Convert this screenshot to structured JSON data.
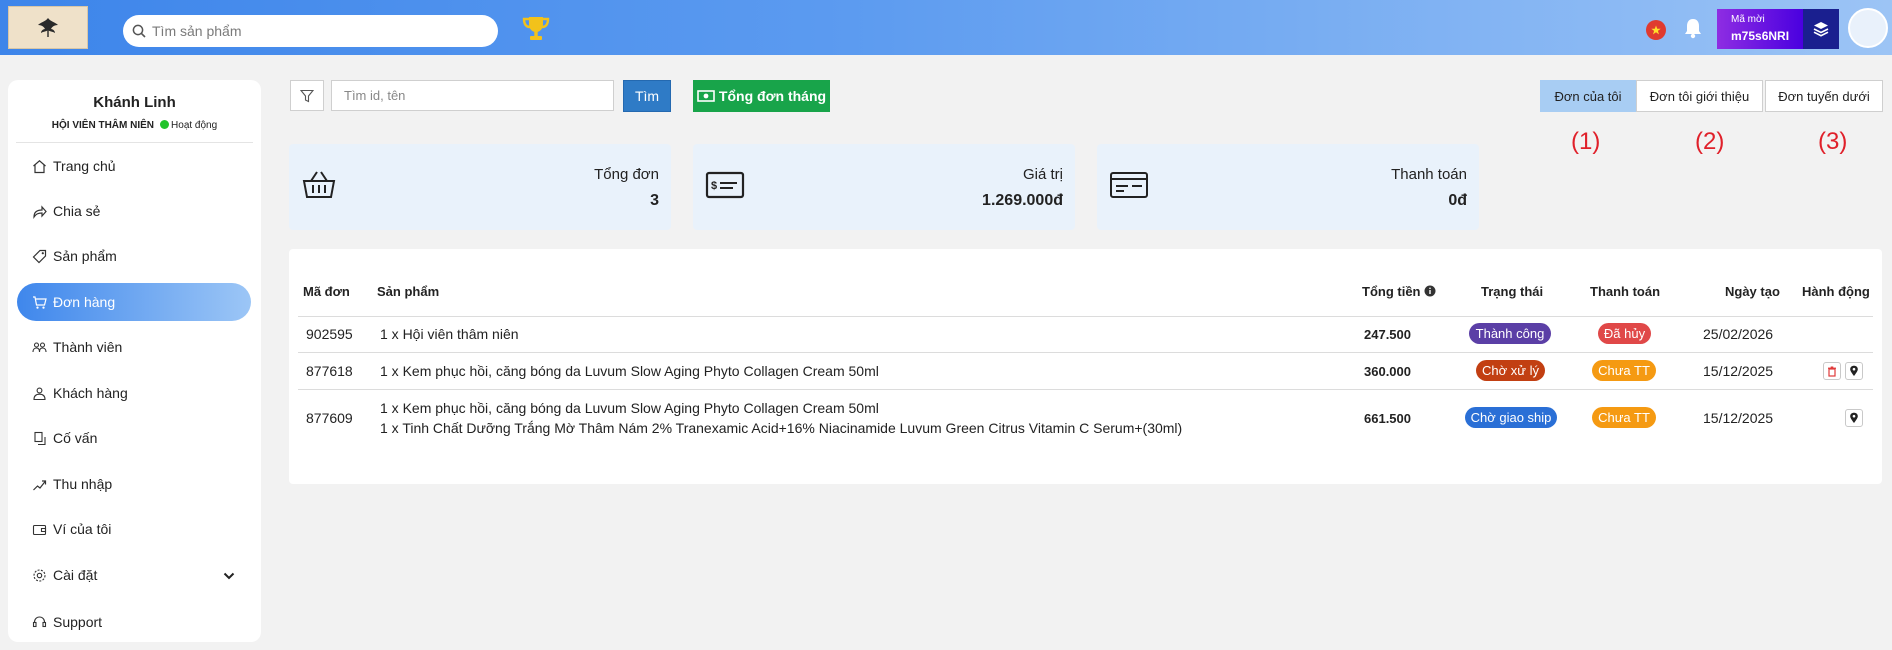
{
  "header": {
    "search_placeholder": "Tìm sản phẩm",
    "invite": {
      "label": "Mã mời",
      "code": "m75s6NRI"
    }
  },
  "sidebar": {
    "user_name": "Khánh Linh",
    "user_rank": "HỘI VIÊN THÂM NIÊN",
    "user_status": "Hoạt động",
    "items": [
      {
        "label": "Trang chủ",
        "icon": "home-icon"
      },
      {
        "label": "Chia sẻ",
        "icon": "share-icon"
      },
      {
        "label": "Sản phẩm",
        "icon": "tag-icon"
      },
      {
        "label": "Đơn hàng",
        "icon": "cart-icon",
        "active": true
      },
      {
        "label": "Thành viên",
        "icon": "users-icon"
      },
      {
        "label": "Khách hàng",
        "icon": "customers-icon"
      },
      {
        "label": "Cố vấn",
        "icon": "advisor-icon"
      },
      {
        "label": "Thu nhập",
        "icon": "income-icon"
      },
      {
        "label": "Ví của tôi",
        "icon": "wallet-icon"
      },
      {
        "label": "Cài đặt",
        "icon": "settings-icon"
      },
      {
        "label": "Support",
        "icon": "support-icon"
      }
    ]
  },
  "filter": {
    "find_placeholder": "Tìm id, tên",
    "find_button": "Tìm",
    "month_button": "Tổng đơn tháng"
  },
  "tabs": [
    {
      "label": "Đơn của tôi",
      "marker": "(1)",
      "active": true
    },
    {
      "label": "Đơn tôi giới thiệu",
      "marker": "(2)"
    },
    {
      "label": "Đơn tuyến dưới",
      "marker": "(3)"
    }
  ],
  "stats": [
    {
      "label": "Tổng đơn",
      "value": "3"
    },
    {
      "label": "Giá trị",
      "value": "1.269.000đ"
    },
    {
      "label": "Thanh toán",
      "value": "0đ"
    }
  ],
  "table": {
    "headers": {
      "id": "Mã đơn",
      "product": "Sản phẩm",
      "total": "Tổng tiền",
      "status": "Trạng thái",
      "payment": "Thanh toán",
      "date": "Ngày tạo",
      "action": "Hành động"
    },
    "rows": [
      {
        "id": "902595",
        "products": [
          "1 x Hội viên thâm niên"
        ],
        "total": "247.500",
        "status": "Thành công",
        "payment": "Đã hủy",
        "date": "25/02/2026"
      },
      {
        "id": "877618",
        "products": [
          "1 x Kem phục hồi, căng bóng da Luvum Slow Aging Phyto Collagen Cream 50ml"
        ],
        "total": "360.000",
        "status": "Chờ xử lý",
        "payment": "Chưa TT",
        "date": "15/12/2025"
      },
      {
        "id": "877609",
        "products": [
          "1 x Kem phục hồi, căng bóng da Luvum Slow Aging Phyto Collagen Cream 50ml",
          "1 x Tinh Chất Dưỡng Trắng Mờ Thâm Nám 2% Tranexamic Acid+16% Niacinamide Luvum Green Citrus Vitamin C Serum+(30ml)"
        ],
        "total": "661.500",
        "status": "Chờ giao ship",
        "payment": "Chưa TT",
        "date": "15/12/2025"
      }
    ]
  },
  "colors": {
    "status_success": "#5b3fa6",
    "status_pending": "#c23f12",
    "status_shipping": "#2a6fd6",
    "payment_cancelled": "#e04848",
    "payment_unpaid": "#f59a12"
  }
}
